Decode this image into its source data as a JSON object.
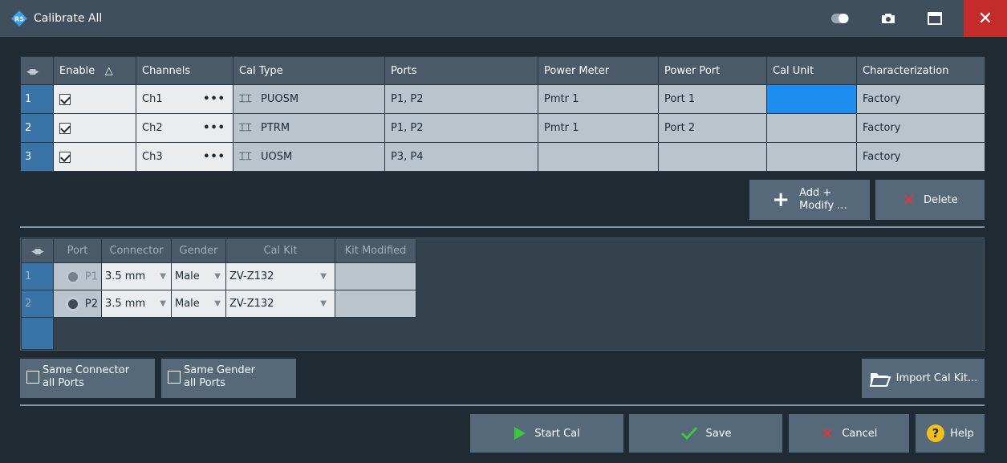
{
  "window": {
    "title": "Calibrate All",
    "close_label": "✕"
  },
  "top_table": {
    "headers": [
      "Enable",
      "Channels",
      "Cal Type",
      "Ports",
      "Power Meter",
      "Power Port",
      "Cal Unit",
      "Characterization"
    ],
    "sort_indicator": "△",
    "rows": [
      {
        "num": "1",
        "enabled": true,
        "channel": "Ch1",
        "cal_type": "PUOSM",
        "ports": "P1, P2",
        "power_meter": "Pmtr 1",
        "power_port": "Port 1",
        "cal_unit": "",
        "characterization": "Factory"
      },
      {
        "num": "2",
        "enabled": true,
        "channel": "Ch2",
        "cal_type": "PTRM",
        "ports": "P1, P2",
        "power_meter": "Pmtr 1",
        "power_port": "Port 2",
        "cal_unit": "",
        "characterization": "Factory"
      },
      {
        "num": "3",
        "enabled": true,
        "channel": "Ch3",
        "cal_type": "UOSM",
        "ports": "P3, P4",
        "power_meter": "",
        "power_port": "",
        "cal_unit": "",
        "characterization": "Factory"
      }
    ],
    "selected_cell_color": "#1f8df0"
  },
  "buttons": {
    "add_modify_line1": "Add +",
    "add_modify_line2": "Modify ...",
    "delete": "Delete",
    "import_cal_kit": "Import Cal Kit...",
    "start_cal": "Start Cal",
    "save": "Save",
    "cancel": "Cancel",
    "help": "Help"
  },
  "port_table": {
    "headers": [
      "Port",
      "Connector",
      "Gender",
      "Cal Kit",
      "Kit Modified"
    ],
    "rows": [
      {
        "num": "1",
        "port": "P1",
        "connector": "3.5 mm",
        "gender": "Male",
        "cal_kit": "ZV-Z132",
        "kit_modified": ""
      },
      {
        "num": "2",
        "port": "P2",
        "connector": "3.5 mm",
        "gender": "Male",
        "cal_kit": "ZV-Z132",
        "kit_modified": ""
      }
    ]
  },
  "options": {
    "same_connector_line1": "Same Connector",
    "same_connector_line2": "all Ports",
    "same_connector_checked": false,
    "same_gender_line1": "Same Gender",
    "same_gender_line2": "all Ports",
    "same_gender_checked": false
  },
  "colors": {
    "accent_blue": "#1f8df0",
    "close_red": "#c42b2b",
    "start_green": "#3cc83c",
    "cancel_red": "#e8332f",
    "help_yellow": "#f2c01a"
  }
}
